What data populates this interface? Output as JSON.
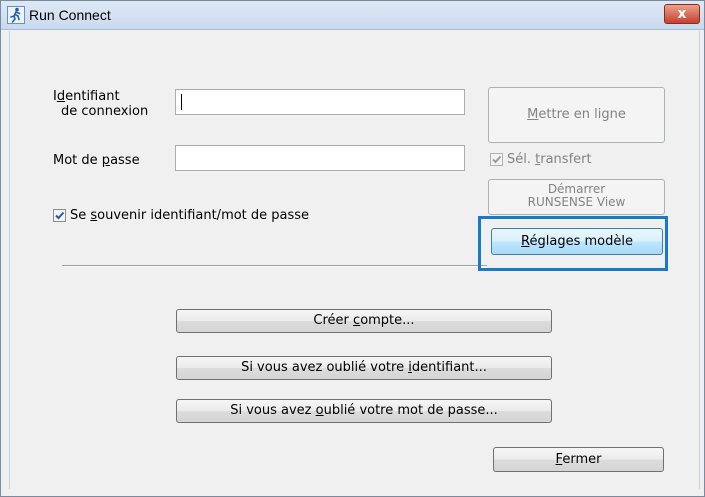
{
  "window": {
    "title": "Run Connect",
    "close_glyph": "x"
  },
  "form": {
    "id_label_line1_pre": "I",
    "id_label_line1_u": "d",
    "id_label_line1_post": "entifiant",
    "id_label_line2": "de connexion",
    "id_value": "",
    "pwd_label_pre": "Mot de ",
    "pwd_label_u": "p",
    "pwd_label_post": "asse",
    "pwd_value": "",
    "remember_pre": "Se ",
    "remember_u": "s",
    "remember_post": "ouvenir identifiant/mot de passe",
    "remember_checked": true
  },
  "right_panel": {
    "upload_u": "M",
    "upload_post": "ettre en ligne",
    "transfer_pre": "Sél. ",
    "transfer_u": "t",
    "transfer_post": "ransfert",
    "transfer_checked": true,
    "runsense_line1": "Démarrer",
    "runsense_line2": "RUNSENSE View",
    "settings_u": "R",
    "settings_post": "églages modèle"
  },
  "bottom_buttons": {
    "create_pre": "Créer ",
    "create_u": "c",
    "create_post": "ompte...",
    "forgot_id_pre": "Si vous avez oublié votre ",
    "forgot_id_u": "i",
    "forgot_id_post": "dentifiant...",
    "forgot_pwd_pre": "Si vous avez ",
    "forgot_pwd_u": "o",
    "forgot_pwd_post": "ublié votre mot de passe...",
    "close_u": "F",
    "close_post": "ermer"
  },
  "colors": {
    "highlight": "#1a79c8",
    "close_button": "#c7412c",
    "title_gradient": "#c9daee"
  },
  "icons": {
    "app": "runner-icon",
    "close": "close-icon",
    "check": "check-icon"
  }
}
